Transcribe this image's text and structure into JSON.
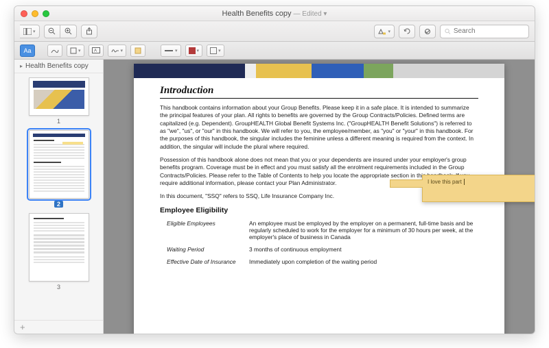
{
  "window": {
    "title": "Health Benefits copy",
    "edited": "— Edited ▾"
  },
  "search": {
    "placeholder": "Search"
  },
  "markup": {
    "aa_label": "Aa"
  },
  "sidebar": {
    "title": "Health Benefits copy",
    "pages": [
      {
        "num": "1"
      },
      {
        "num": "2"
      },
      {
        "num": "3"
      }
    ]
  },
  "annotation": {
    "note_text": "I love this part"
  },
  "doc": {
    "h1": "Introduction",
    "p1": "This handbook contains information about your Group Benefits.  Please keep it in a safe place.  It is intended to summarize the principal features of your plan.  All rights to benefits are governed by the Group Contracts/Policies.  Defined terms are capitalized (e.g. Dependent).  GroupHEALTH Global Benefit Systems Inc. (\"GroupHEALTH Benefit Solutions\") is referred to as \"we\", \"us\", or \"our\" in this handbook.  We will refer to you, the employee/member, as \"you\" or \"your\" in this handbook.  For the purposes of this handbook, the singular includes the feminine unless a different meaning is required from the context.  In addition, the singular will include the plural where required.",
    "p2": "Possession of this handbook alone does not mean that you or your dependents are insured under your employer's group benefits program.  Coverage must be in effect and you must satisfy all the enrolment requirements included in the Group Contracts/Policies.  Please refer to the Table of Contents to help you locate the appropriate section in this handbook.  If you require additional information, please contact your Plan Administrator.",
    "p3": "In this document, \"SSQ\" refers to SSQ, Life Insurance Company Inc.",
    "h2": "Employee Eligibility",
    "rows": [
      {
        "k": "Eligible Employees",
        "v": "An employee must be employed by the employer on a permanent, full-time basis and be regularly scheduled to work for the employer for a minimum of 30 hours per week, at the employer's place of business in Canada"
      },
      {
        "k": "Waiting Period",
        "v": "3 months of continuous employment"
      },
      {
        "k": "Effective Date of Insurance",
        "v": "Immediately upon completion of the waiting period"
      }
    ]
  }
}
